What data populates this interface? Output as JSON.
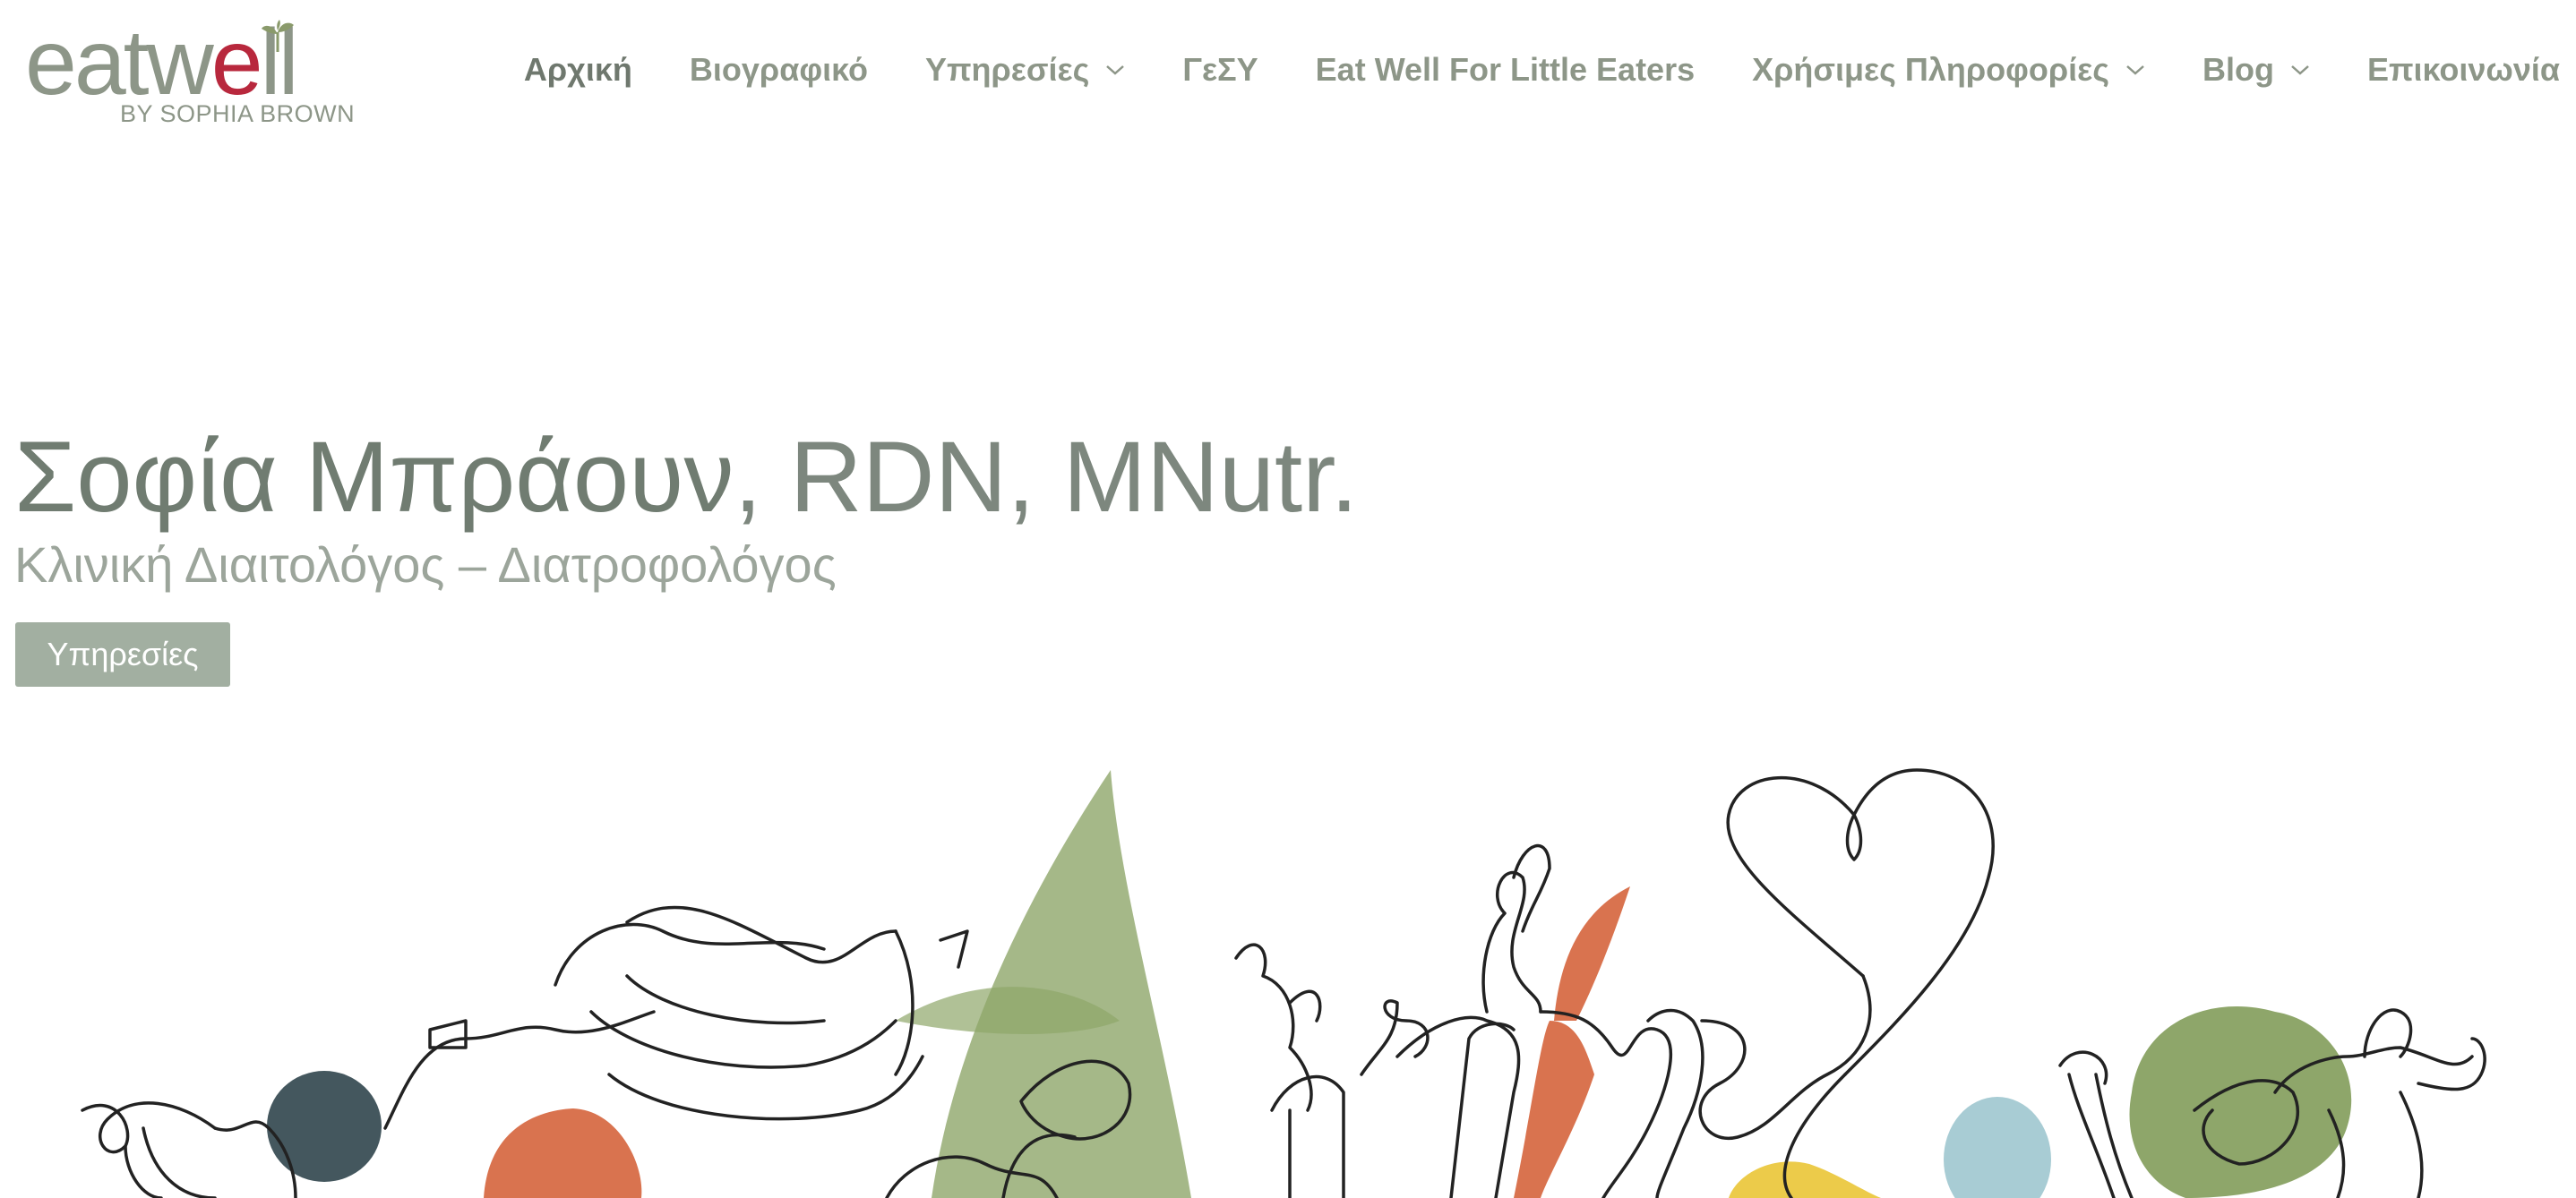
{
  "logo": {
    "word_parts": [
      "eat",
      "w",
      "e",
      "ll"
    ],
    "subtitle": "BY SOPHIA BROWN"
  },
  "nav": {
    "items": [
      {
        "label": "Αρχική",
        "active": true,
        "dropdown": false
      },
      {
        "label": "Βιογραφικό",
        "active": false,
        "dropdown": false
      },
      {
        "label": "Υπηρεσίες",
        "active": false,
        "dropdown": true
      },
      {
        "label": "ΓεΣΥ",
        "active": false,
        "dropdown": false
      },
      {
        "label": "Eat Well For Little Eaters",
        "active": false,
        "dropdown": false
      },
      {
        "label": "Χρήσιμες Πληροφορίες",
        "active": false,
        "dropdown": true
      },
      {
        "label": "Blog",
        "active": false,
        "dropdown": true
      },
      {
        "label": "Επικοινωνία",
        "active": false,
        "dropdown": false
      }
    ]
  },
  "hero": {
    "name": "Σοφία Μπράουν",
    "credentials": ", RDN, MNutr.",
    "subtitle": "Κλινική Διαιτολόγος – Διατροφολόγος",
    "cta_label": "Υπηρεσίες"
  },
  "colors": {
    "brand_gray": "#8d9688",
    "brand_red": "#b8283d",
    "brand_leaf": "#8a9a6b",
    "cta_bg": "#a2afa1",
    "illustration_orange": "#d9734f",
    "illustration_green": "#8ea66a",
    "illustration_slate": "#44575e",
    "illustration_blue": "#a8ccd4",
    "illustration_yellow": "#eccb4a"
  },
  "icons": [
    "leaf-icon",
    "chevron-down-icon"
  ],
  "illustration": {
    "name": "vegetables-line-art"
  }
}
